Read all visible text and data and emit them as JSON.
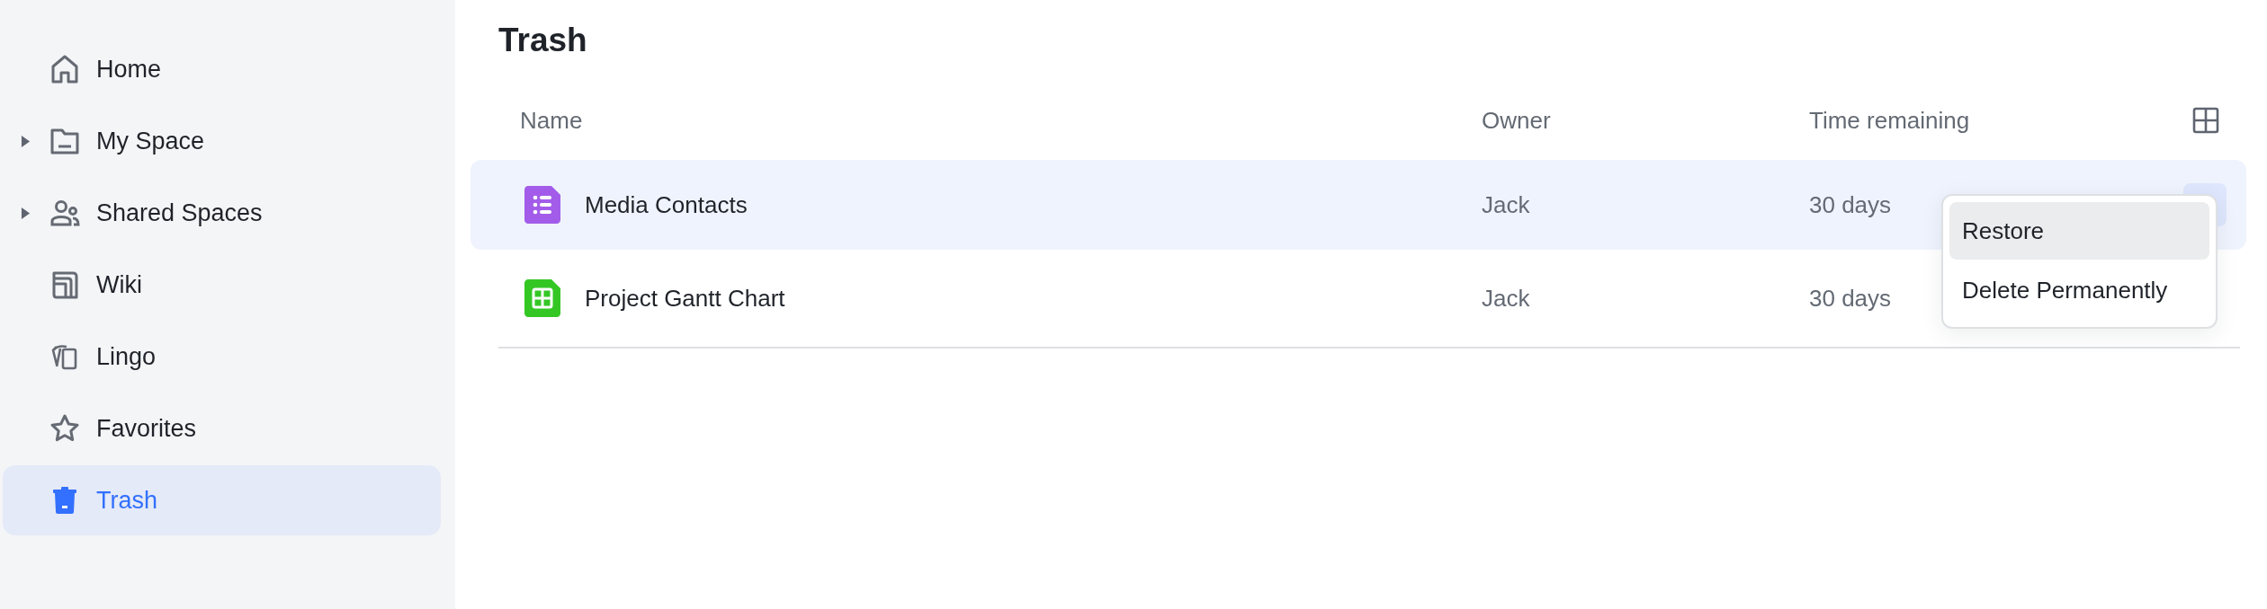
{
  "sidebar": {
    "items": [
      {
        "label": "Home",
        "expandable": false,
        "selected": false
      },
      {
        "label": "My Space",
        "expandable": true,
        "selected": false
      },
      {
        "label": "Shared Spaces",
        "expandable": true,
        "selected": false
      },
      {
        "label": "Wiki",
        "expandable": false,
        "selected": false
      },
      {
        "label": "Lingo",
        "expandable": false,
        "selected": false
      },
      {
        "label": "Favorites",
        "expandable": false,
        "selected": false
      },
      {
        "label": "Trash",
        "expandable": false,
        "selected": true
      }
    ]
  },
  "page": {
    "title": "Trash"
  },
  "table": {
    "columns": [
      "Name",
      "Owner",
      "Time remaining"
    ],
    "rows": [
      {
        "kind": "form",
        "color": "#a25ce9",
        "name": "Media Contacts",
        "owner": "Jack",
        "time_remaining": "30 days",
        "selected": true
      },
      {
        "kind": "sheet",
        "color": "#34c724",
        "name": "Project Gantt Chart",
        "owner": "Jack",
        "time_remaining": "30 days",
        "selected": false
      }
    ]
  },
  "context_menu": {
    "items": [
      {
        "label": "Restore",
        "selected": true
      },
      {
        "label": "Delete Permanently",
        "selected": false
      }
    ]
  }
}
